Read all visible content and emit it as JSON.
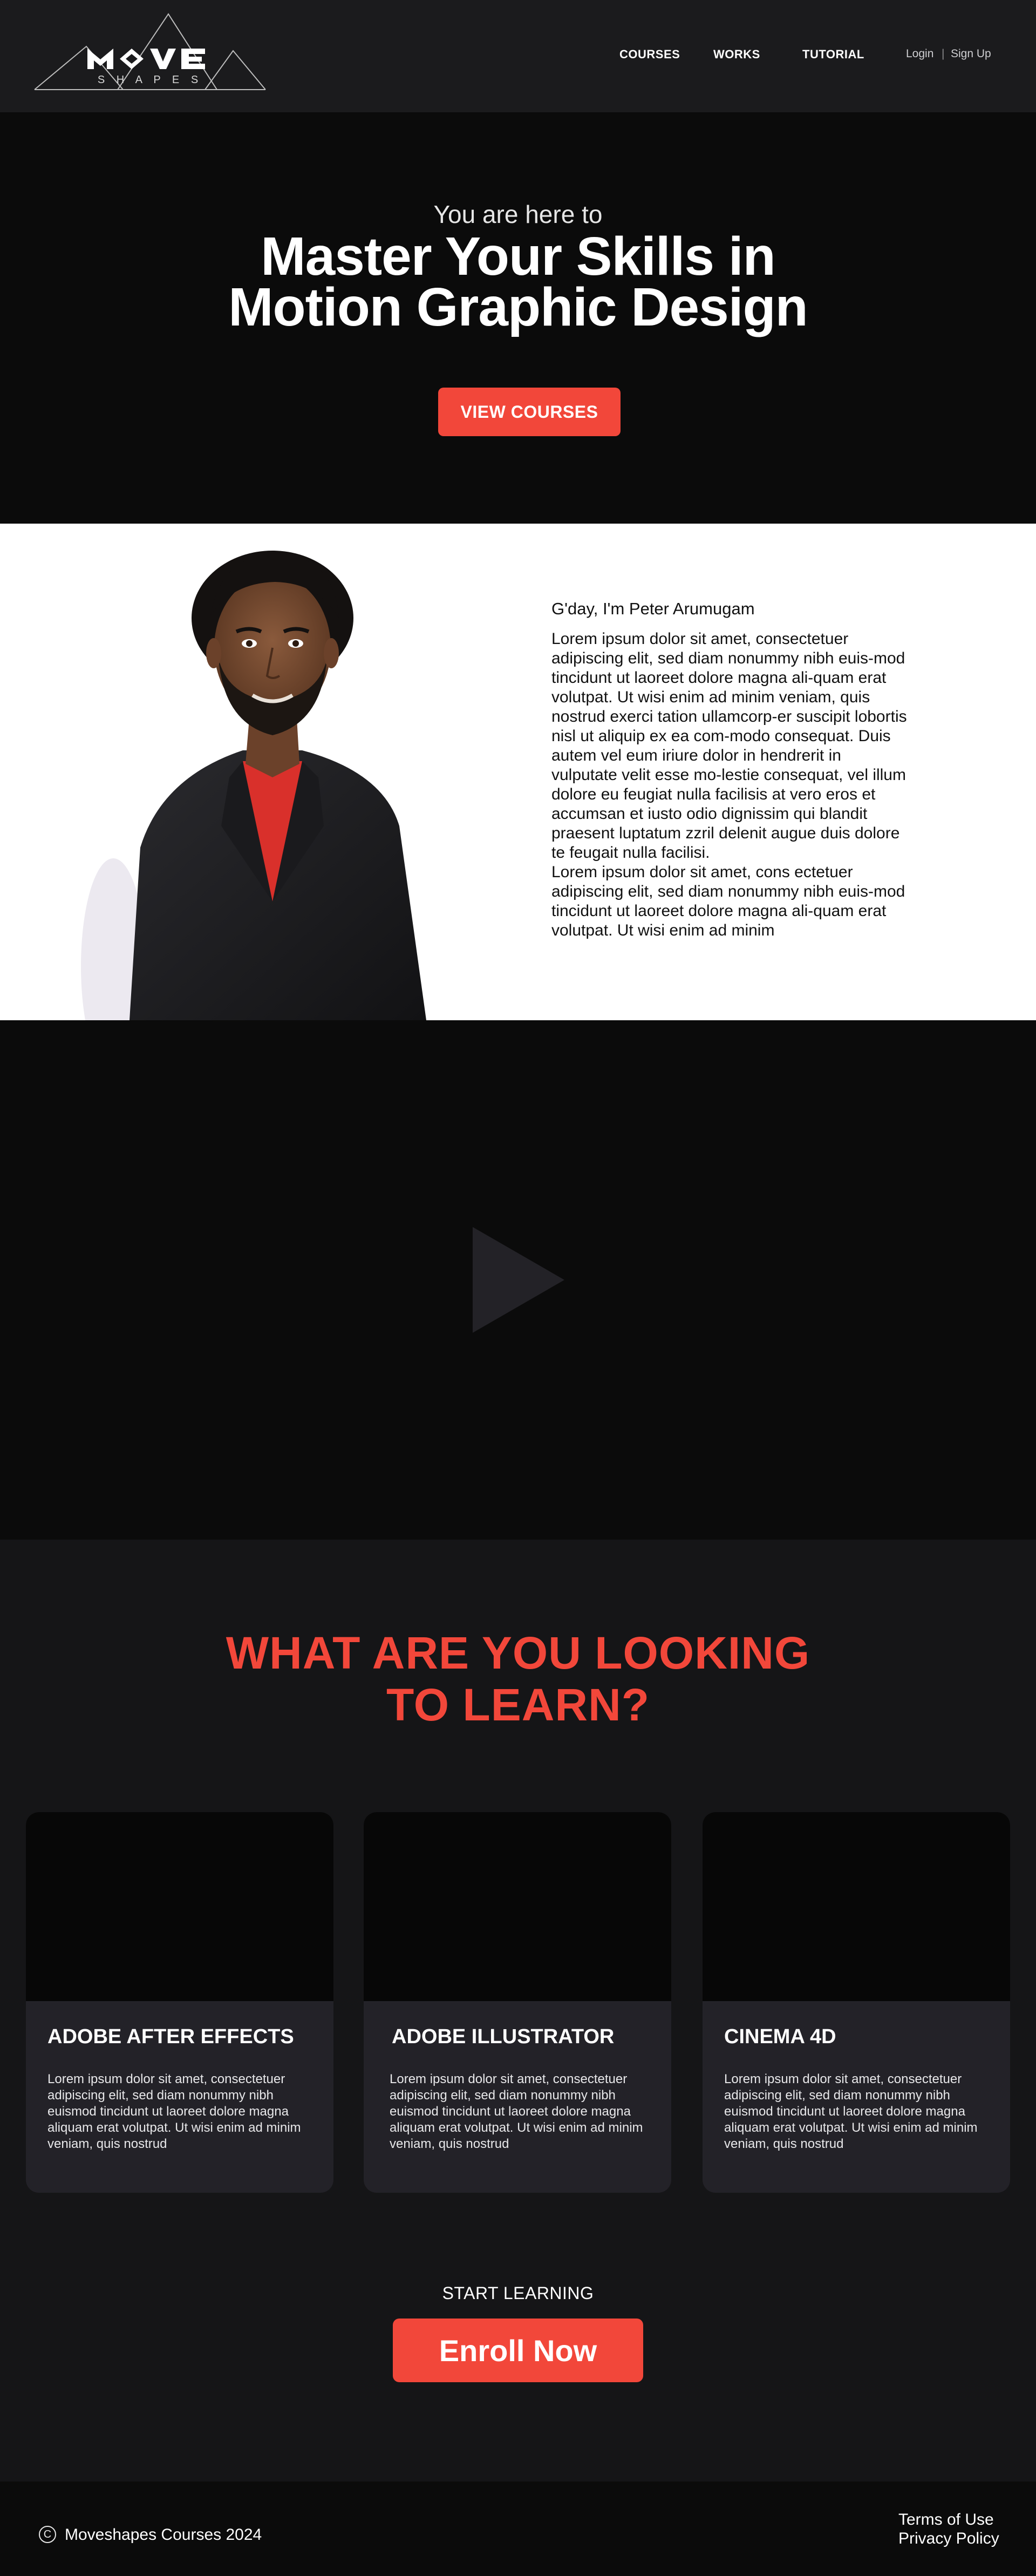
{
  "header": {
    "logo_word": "MOVE",
    "logo_sub": "S H A P E S",
    "nav": [
      {
        "label": "COURSES"
      },
      {
        "label": "WORKS"
      },
      {
        "label": "TUTORIAL"
      }
    ],
    "login_label": "Login",
    "separator": "|",
    "signup_label": "Sign Up"
  },
  "hero": {
    "subtitle": "You are here to",
    "title_line1": "Master Your Skills in",
    "title_line2": "Motion Graphic Design",
    "cta_label": "VIEW COURSES"
  },
  "about": {
    "greeting": "G'day, I'm Peter Arumugam",
    "paragraph1": "Lorem ipsum dolor sit amet, consectetuer adipiscing elit, sed diam nonummy nibh euis-mod tincidunt ut laoreet dolore magna ali-quam erat volutpat. Ut wisi enim ad minim veniam, quis nostrud exerci tation ullamcorp-er suscipit lobortis nisl ut aliquip ex ea com-modo consequat. Duis autem vel eum iriure dolor in hendrerit in vulputate velit esse mo-lestie consequat, vel illum dolore eu feugiat nulla facilisis at vero eros et accumsan et iusto odio dignissim qui blandit praesent luptatum zzril delenit augue duis dolore te feugait nulla facilisi.",
    "paragraph2": "Lorem ipsum dolor sit amet, cons ectetuer adipiscing elit, sed diam nonummy nibh euis-mod tincidunt ut laoreet dolore magna ali-quam erat volutpat. Ut wisi enim ad minim"
  },
  "learn": {
    "title_line1": "WHAT ARE YOU LOOKING",
    "title_line2": "TO LEARN?",
    "cards": [
      {
        "title": "ADOBE AFTER EFFECTS",
        "desc": "Lorem ipsum dolor sit amet, consectetuer adipiscing elit, sed diam nonummy nibh euismod tincidunt ut laoreet dolore magna aliquam erat volutpat. Ut wisi enim ad minim veniam, quis nostrud"
      },
      {
        "title": "ADOBE ILLUSTRATOR",
        "desc": "Lorem ipsum dolor sit amet, consectetuer adipiscing elit, sed diam nonummy nibh euismod tincidunt ut laoreet dolore magna aliquam erat volutpat. Ut wisi enim ad minim veniam, quis nostrud"
      },
      {
        "title": "CINEMA 4D",
        "desc": "Lorem ipsum dolor sit amet, consectetuer adipiscing elit, sed diam nonummy nibh euismod tincidunt ut laoreet dolore magna aliquam erat volutpat. Ut wisi enim ad minim veniam, quis nostrud"
      }
    ],
    "start_label": "START LEARNING",
    "enroll_label": "Enroll Now"
  },
  "footer": {
    "copyright_symbol": "C",
    "copyright": "Moveshapes Courses 2024",
    "terms": "Terms of Use",
    "privacy": "Privacy Policy"
  },
  "colors": {
    "accent": "#f2473a",
    "header_bg": "#1b1b1d",
    "hero_bg": "#0b0b0b",
    "section_bg": "#151517",
    "card_bg": "#232228"
  },
  "icons": {
    "logo": "move-shapes-logo",
    "play": "play-icon",
    "copyright": "copyright-icon"
  }
}
